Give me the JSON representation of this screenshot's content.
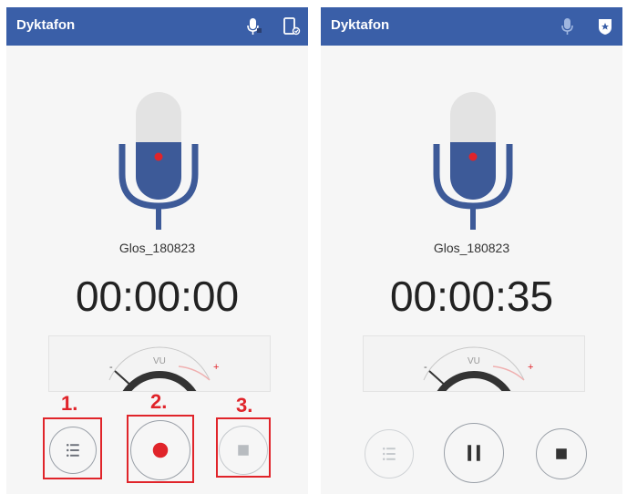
{
  "left_screen": {
    "app_title": "Dyktafon",
    "file_name": "Glos_180823",
    "timer": "00:00:00",
    "vu_label": "VU",
    "vu_minus": "-",
    "vu_plus": "+",
    "annotations": [
      "1.",
      "2.",
      "3."
    ],
    "icons": [
      "microphone-icon",
      "device-icon",
      "list-icon",
      "record-icon",
      "stop-icon"
    ]
  },
  "right_screen": {
    "app_title": "Dyktafon",
    "file_name": "Glos_180823",
    "timer": "00:00:35",
    "vu_label": "VU",
    "vu_minus": "-",
    "vu_plus": "+",
    "icons": [
      "microphone-icon",
      "shield-icon",
      "list-icon",
      "pause-icon",
      "stop-icon"
    ]
  },
  "colors": {
    "appbar": "#3a5fa8",
    "mic_fill": "#3d5a98",
    "record_red": "#e0242a",
    "annotation_red": "#e0242a"
  }
}
